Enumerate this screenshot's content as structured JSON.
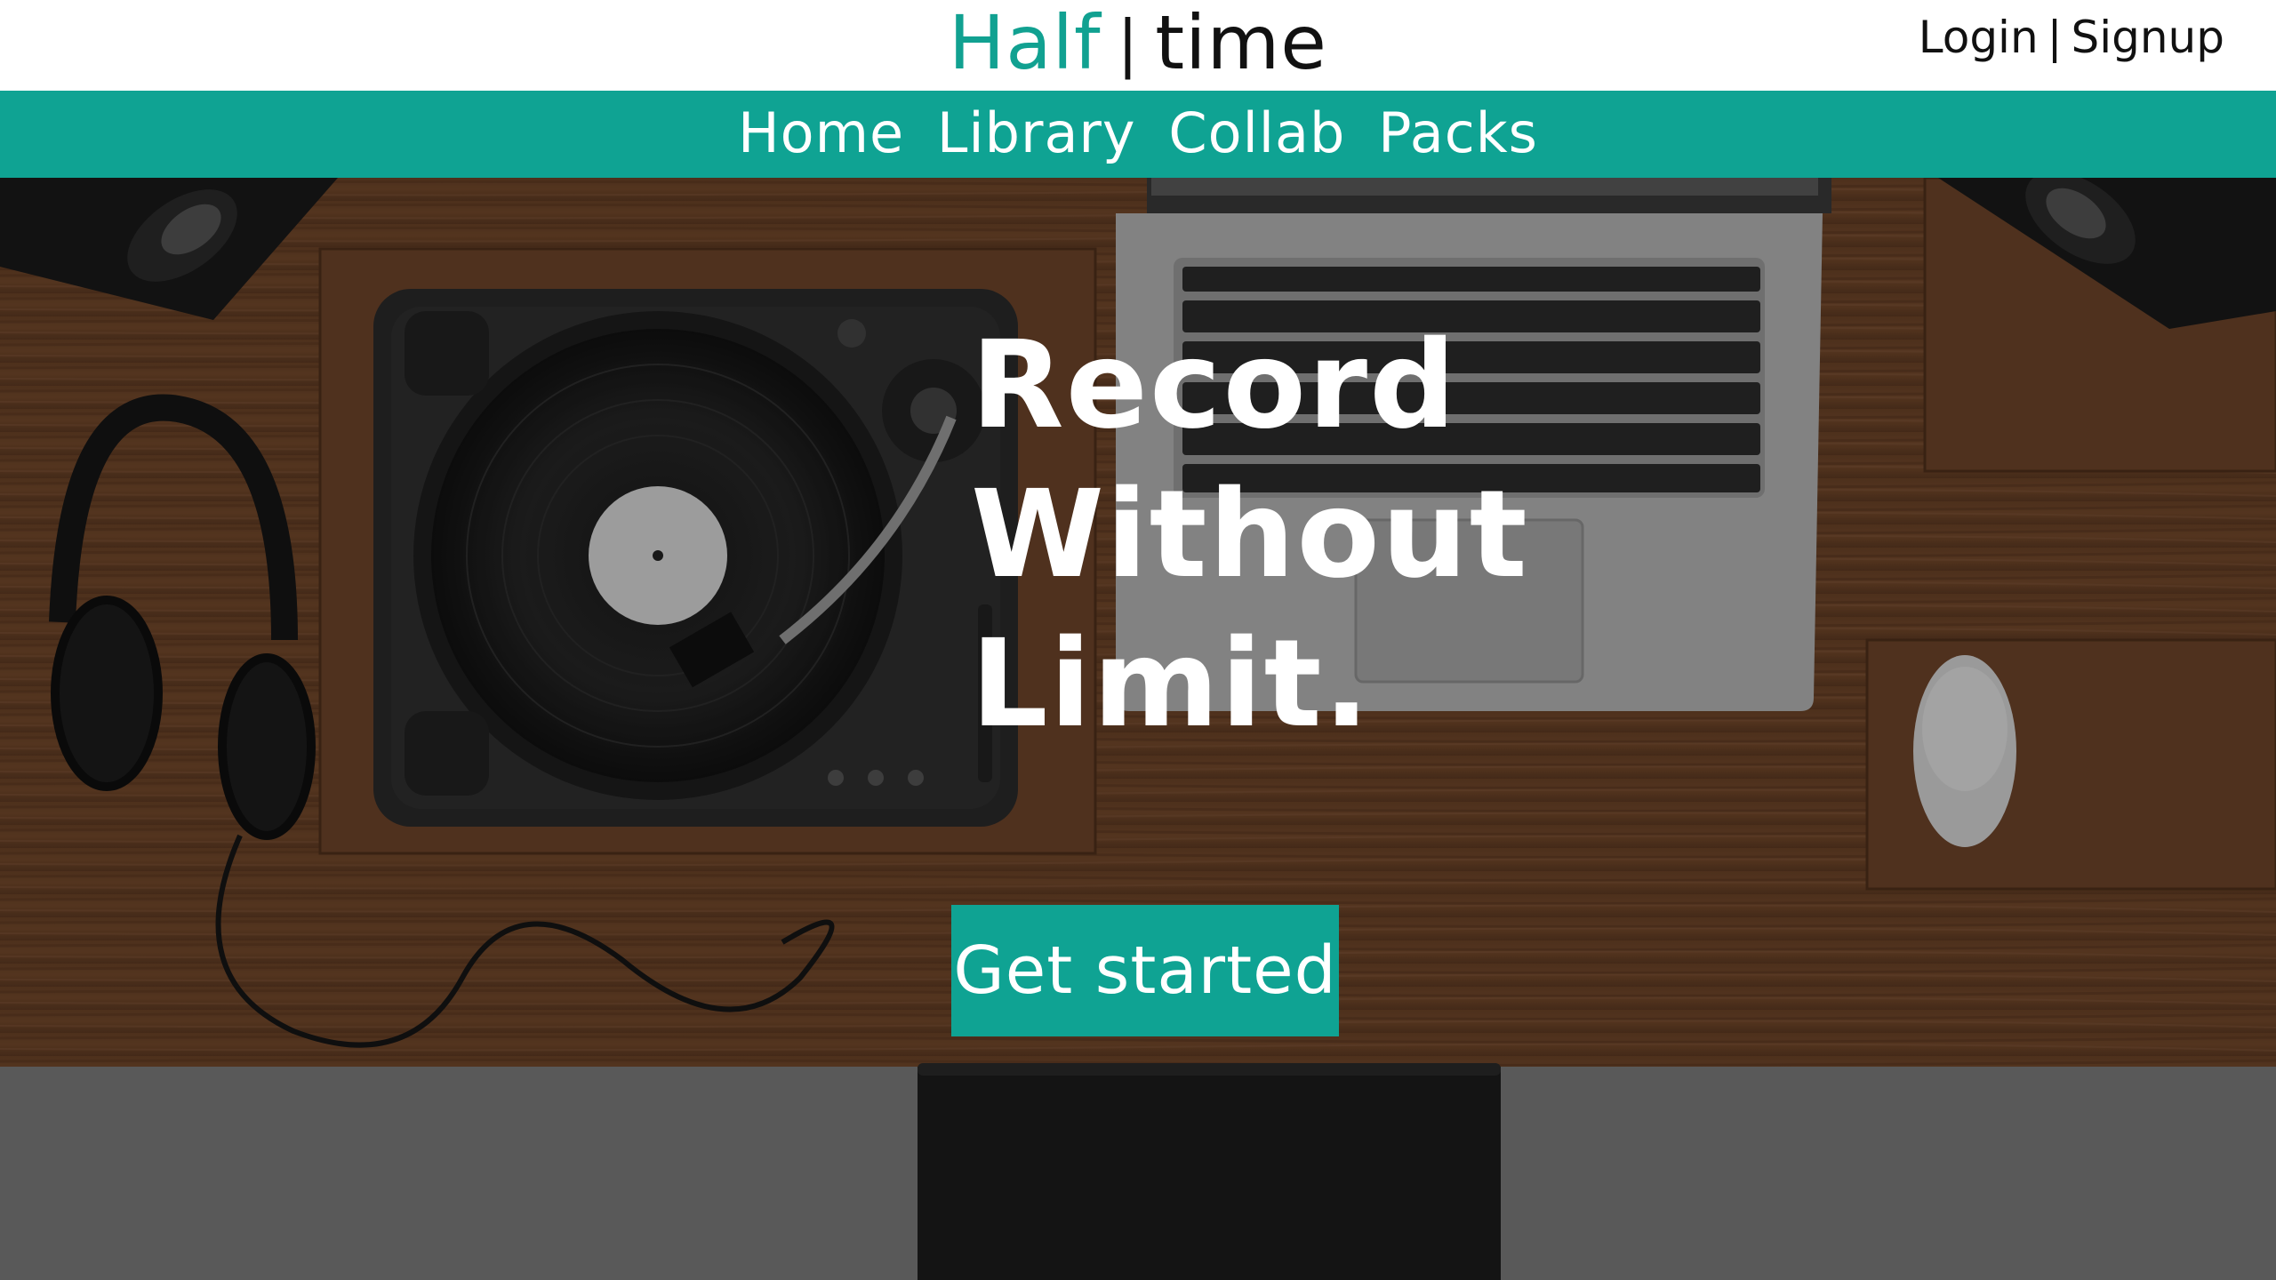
{
  "brand": {
    "half": "Half",
    "separator": "|",
    "time": "time",
    "accent_color": "#0fa393"
  },
  "auth": {
    "login": "Login",
    "separator": "|",
    "signup": "Signup"
  },
  "nav": {
    "items": [
      "Home",
      "Library",
      "Collab",
      "Packs"
    ]
  },
  "hero": {
    "headline_lines": [
      "Record",
      "Without",
      "Limit."
    ],
    "cta_label": "Get started",
    "background": "desk-with-turntable-laptop-headphones-speakers"
  },
  "icons": {
    "headphones": "headphones-icon",
    "turntable": "turntable-icon",
    "laptop": "laptop-icon",
    "mouse": "mouse-icon",
    "speaker": "speaker-icon"
  }
}
